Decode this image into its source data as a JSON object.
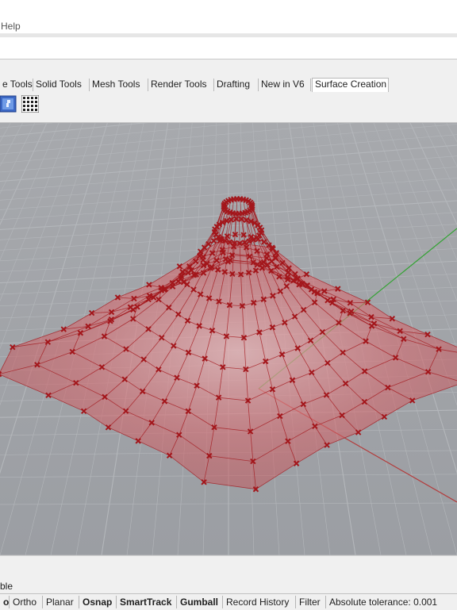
{
  "menu": {
    "help_label": "Help"
  },
  "tabs": [
    {
      "label": "e Tools"
    },
    {
      "label": "Solid Tools"
    },
    {
      "label": "Mesh Tools"
    },
    {
      "label": "Render Tools"
    },
    {
      "label": "Drafting"
    },
    {
      "label": "New in V6"
    },
    {
      "label": "Surface Creation",
      "active": true
    }
  ],
  "toolbar": {
    "icons": [
      "surface-from-points-icon",
      "point-grid-icon"
    ]
  },
  "command_history": {
    "last_line": "ble"
  },
  "statusbar": {
    "items": [
      {
        "label": "o",
        "active": true
      },
      {
        "label": "Ortho",
        "active": false
      },
      {
        "label": "Planar",
        "active": false
      },
      {
        "label": "Osnap",
        "active": true
      },
      {
        "label": "SmartTrack",
        "active": true
      },
      {
        "label": "Gumball",
        "active": true
      },
      {
        "label": "Record History",
        "active": false
      },
      {
        "label": "Filter",
        "active": false
      },
      {
        "label": "Absolute tolerance: 0.001",
        "active": false
      }
    ]
  },
  "colors": {
    "viewport_bg": "#a2a5aa",
    "grid_line": "#b4b7bb",
    "surface_fill": "#c84b50",
    "control_point": "#a3161b",
    "x_axis": "#b03a3a",
    "y_axis": "#33a033"
  }
}
